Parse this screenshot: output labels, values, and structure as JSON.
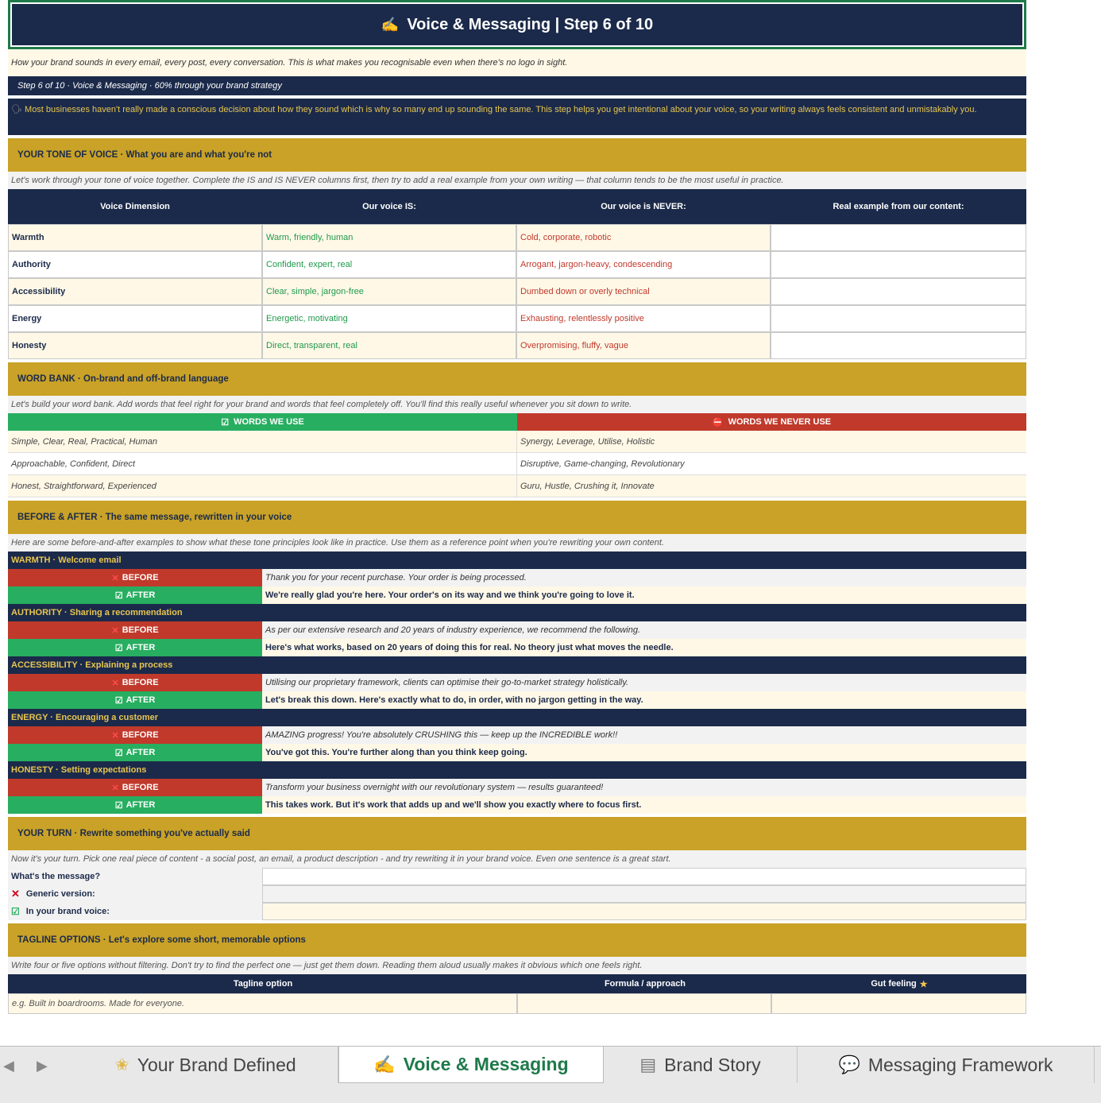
{
  "header": {
    "title": "Voice & Messaging  |  Step 6 of 10"
  },
  "intro": "How your brand sounds in every email, every post, every conversation. This is what makes you recognisable even when there's no logo in sight.",
  "step_strip": "Step 6 of 10  ·   Voice & Messaging  ·   60% through your brand strategy",
  "note": "Most businesses haven't really made a conscious decision about how they sound which is why so many end up sounding the same. This step helps you get intentional about your voice, so your writing always feels consistent and unmistakably you.",
  "tone": {
    "section": "YOUR TONE OF VOICE  ·  What you are and what you're not",
    "hint": "Let's work through your tone of voice together. Complete the IS and IS NEVER columns first, then try to add a real example from your own writing — that column tends to be the most useful in practice.",
    "headers": [
      "Voice Dimension",
      "Our voice IS:",
      "Our voice is NEVER:",
      "Real example from our content:"
    ],
    "rows": [
      {
        "dimension": "Warmth",
        "is": "Warm, friendly, human",
        "never": "Cold, corporate, robotic",
        "example": ""
      },
      {
        "dimension": "Authority",
        "is": "Confident, expert, real",
        "never": "Arrogant, jargon-heavy, condescending",
        "example": ""
      },
      {
        "dimension": "Accessibility",
        "is": "Clear, simple, jargon-free",
        "never": "Dumbed down or overly technical",
        "example": ""
      },
      {
        "dimension": "Energy",
        "is": "Energetic, motivating",
        "never": "Exhausting, relentlessly positive",
        "example": ""
      },
      {
        "dimension": "Honesty",
        "is": "Direct, transparent, real",
        "never": "Overpromising, fluffy, vague",
        "example": ""
      }
    ]
  },
  "wordbank": {
    "section": "WORD BANK  ·  On-brand and off-brand language",
    "hint": "Let's build your word bank. Add words that feel right for your brand and words that feel completely off. You'll find this really useful whenever you sit down to write.",
    "use_header": "WORDS WE USE",
    "never_header": "WORDS WE NEVER USE",
    "rows": [
      {
        "use": "Simple, Clear, Real, Practical, Human",
        "never": "Synergy, Leverage, Utilise, Holistic"
      },
      {
        "use": "Approachable, Confident, Direct",
        "never": "Disruptive, Game-changing, Revolutionary"
      },
      {
        "use": "Honest, Straightforward, Experienced",
        "never": "Guru, Hustle, Crushing it, Innovate"
      }
    ]
  },
  "beforeafter": {
    "section": "BEFORE & AFTER  ·  The same message, rewritten in your voice",
    "hint": "Here are some before-and-after examples to show what these tone principles look like in practice. Use them as a reference point when you're rewriting your own content.",
    "before_label": "BEFORE",
    "after_label": "AFTER",
    "items": [
      {
        "label": "WARMTH  ·  Welcome email",
        "before": "Thank you for your recent purchase. Your order is being processed.",
        "after": "We're really glad you're here. Your order's on its way and we think you're going to love it."
      },
      {
        "label": "AUTHORITY  ·  Sharing a recommendation",
        "before": "As per our extensive research and 20 years of industry experience, we recommend the following.",
        "after": "Here's what works, based on 20 years of doing this for real. No theory just what moves the needle."
      },
      {
        "label": "ACCESSIBILITY  ·  Explaining a process",
        "before": "Utilising our proprietary framework, clients can optimise their go-to-market strategy holistically.",
        "after": "Let's break this down. Here's exactly what to do, in order, with no jargon getting in the way."
      },
      {
        "label": "ENERGY  ·  Encouraging a customer",
        "before": "AMAZING progress! You're absolutely CRUSHING this — keep up the INCREDIBLE work!!",
        "after": "You've got this. You're further along than you think keep going."
      },
      {
        "label": "HONESTY  ·  Setting expectations",
        "before": "Transform your business overnight with our revolutionary system — results guaranteed!",
        "after": "This takes work. But it's work that adds up and we'll show you exactly where to focus first."
      }
    ]
  },
  "yourturn": {
    "section": "YOUR TURN  ·  Rewrite something you've actually said",
    "hint": "Now it's your turn. Pick one real piece of content - a social post, an email, a product description - and try rewriting it in your brand voice. Even one sentence is a great start.",
    "message_label": "What's the message?",
    "generic_label": "Generic version:",
    "brand_label": "In your brand voice:"
  },
  "tagline": {
    "section": "TAGLINE OPTIONS  ·  Let's explore some short, memorable options",
    "hint": "Write four or five options without filtering. Don't try to find the perfect one — just get them down. Reading them aloud usually makes it obvious which one feels right.",
    "headers": [
      "Tagline option",
      "Formula / approach",
      "Gut feeling"
    ],
    "example": "e.g. Built in boardrooms. Made for everyone."
  },
  "tabs": [
    {
      "label": "Your Brand Defined",
      "icon": "star-icon"
    },
    {
      "label": "Voice & Messaging",
      "icon": "writing-hand-icon"
    },
    {
      "label": "Brand Story",
      "icon": "book-icon"
    },
    {
      "label": "Messaging Framework",
      "icon": "speech-bubble-icon"
    }
  ],
  "colors": {
    "navy": "#1b2a4a",
    "gold": "#c9a227",
    "green": "#27ae60",
    "red": "#c0392b",
    "cream": "#fff8e7"
  }
}
